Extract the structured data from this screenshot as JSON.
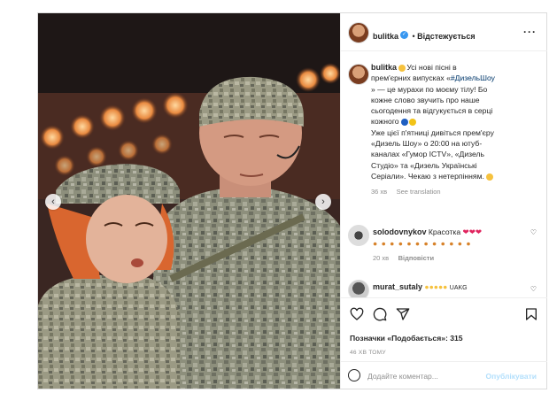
{
  "post": {
    "header": {
      "username": "bulitka",
      "follow_label": "Відстежується",
      "more_icon": "more-horizontal-icon"
    },
    "caption": {
      "username": "bulitka",
      "lines": [
        "Усі нові пісні в",
        "прем'єрних випусках «",
        "#ДизельШоу",
        "» — це мурахи по моєму тілу! Бо",
        "кожне слово звучить про наше",
        "сьогодення та відгукується в серці",
        "кожного",
        "Уже цієї п'ятниці дивіться прем'єру",
        "«Дизель Шоу» о 20:00 на ютуб-",
        "каналах «Гумор ICTV», «Дизель",
        "Студіо» та «Дизель Українські",
        "Серіали». Чекаю з нетерпінням."
      ],
      "time": "36 хв",
      "see_translation": "See translation"
    },
    "comments": [
      {
        "username": "solodovnykov",
        "text": "Красотка",
        "time": "20 хв",
        "reply_label": "Відповісти"
      },
      {
        "username": "murat_sutaly",
        "text": "UAKG"
      }
    ],
    "likes_text": "Позначки «Подобається»: 315",
    "date_text": "46 ХВ ТОМУ",
    "composer": {
      "placeholder": "Додайте коментар...",
      "publish_label": "Опублікувати"
    },
    "colors": {
      "link_blue": "#00376b",
      "verified": "#3897f0",
      "publish_disabled": "#b2dffc",
      "secondary_text": "#8e8e8e"
    },
    "icons": [
      "heart-icon",
      "comment-icon",
      "share-icon",
      "bookmark-icon",
      "emoji-icon",
      "chevron-left-icon",
      "chevron-right-icon"
    ]
  }
}
